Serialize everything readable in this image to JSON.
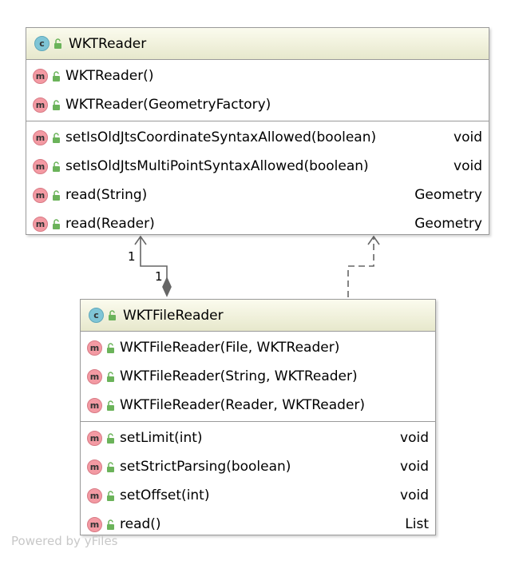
{
  "classes": {
    "wktreader": {
      "title": "WKTReader",
      "constructors": [
        {
          "name": "WKTReader()"
        },
        {
          "name": "WKTReader(GeometryFactory)"
        }
      ],
      "methods": [
        {
          "name": "setIsOldJtsCoordinateSyntaxAllowed(boolean)",
          "type": "void"
        },
        {
          "name": "setIsOldJtsMultiPointSyntaxAllowed(boolean)",
          "type": "void"
        },
        {
          "name": "read(String)",
          "type": "Geometry"
        },
        {
          "name": "read(Reader)",
          "type": "Geometry"
        }
      ]
    },
    "wktfilereader": {
      "title": "WKTFileReader",
      "constructors": [
        {
          "name": "WKTFileReader(File, WKTReader)"
        },
        {
          "name": "WKTFileReader(String, WKTReader)"
        },
        {
          "name": "WKTFileReader(Reader, WKTReader)"
        }
      ],
      "methods": [
        {
          "name": "setLimit(int)",
          "type": "void"
        },
        {
          "name": "setStrictParsing(boolean)",
          "type": "void"
        },
        {
          "name": "setOffset(int)",
          "type": "void"
        },
        {
          "name": "read()",
          "type": "List"
        }
      ]
    }
  },
  "badges": {
    "class": "c",
    "method": "m"
  },
  "edges": {
    "composition": {
      "source_multiplicity": "1",
      "target_multiplicity": "1"
    }
  },
  "watermark": "Powered by yFiles",
  "colors": {
    "header_top": "#fbfbee",
    "header_bottom": "#e7e8cc",
    "class_badge": "#7fc5d6",
    "method_badge": "#f39aa3",
    "lock_green": "#6bb35a",
    "edge_gray": "#666666"
  },
  "icons": {
    "class": "class-c-icon",
    "method": "method-m-icon",
    "visibility": "public-lock-icon"
  }
}
